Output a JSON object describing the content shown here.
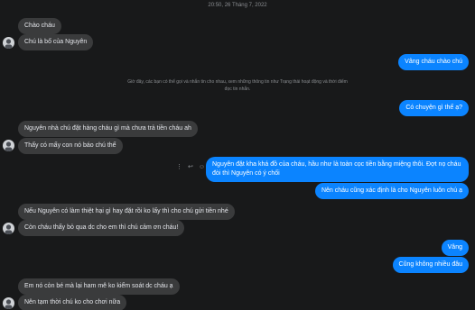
{
  "thread": {
    "timestamp": "20:50, 26 Tháng 7, 2022",
    "notice": "Giờ đây, các bạn có thể gọi và nhắn tin cho nhau, xem những thông tin như Trạng thái hoạt động và thời điểm đọc tin nhắn."
  },
  "messages": [
    {
      "dir": "in",
      "text": "Chào cháu"
    },
    {
      "dir": "in",
      "text": "Chú là bố của Nguyên"
    },
    {
      "dir": "out",
      "text": "Vâng cháu chào chú"
    },
    {
      "dir": "out",
      "text": "Có chuyện gì thế ạ?"
    },
    {
      "dir": "in",
      "text": "Nguyên nhà chú đặt hàng cháu gì mà chưa trả tiền cháu ah"
    },
    {
      "dir": "in",
      "text": "Thấy có mấy con nó báo chú thế"
    },
    {
      "dir": "out",
      "text": "Nguyên đặt kha khá đồ của cháu, hầu như là toàn cọc tiền bằng miệng thôi. Đợt nọ cháu đòi thì Nguyên có ý chối"
    },
    {
      "dir": "out",
      "text": "Nên cháu cũng xác định là cho Nguyên luôn chú ạ"
    },
    {
      "dir": "in",
      "text": "Nếu Nguyên có làm thiệt hại gì hay đặt rồi ko lấy thì cho chú gửi tiền nhé"
    },
    {
      "dir": "in",
      "text": "Còn cháu thấy bỏ qua dc cho em thì chú cảm ơn cháu!"
    },
    {
      "dir": "out",
      "text": "Vâng"
    },
    {
      "dir": "out",
      "text": "Cũng không nhiều đâu"
    },
    {
      "dir": "in",
      "text": "Em nó còn bé mà lại ham mê ko kiểm soát dc cháu ạ"
    },
    {
      "dir": "in",
      "text": "Nên tạm thời chú ko cho chơi nữa"
    }
  ],
  "actions": {
    "more_icon": "⋮",
    "reply_icon": "↩",
    "react_icon": "☺"
  },
  "colors": {
    "background": "#18191a",
    "incoming": "#3a3b3c",
    "outgoing": "#0b84ff"
  }
}
